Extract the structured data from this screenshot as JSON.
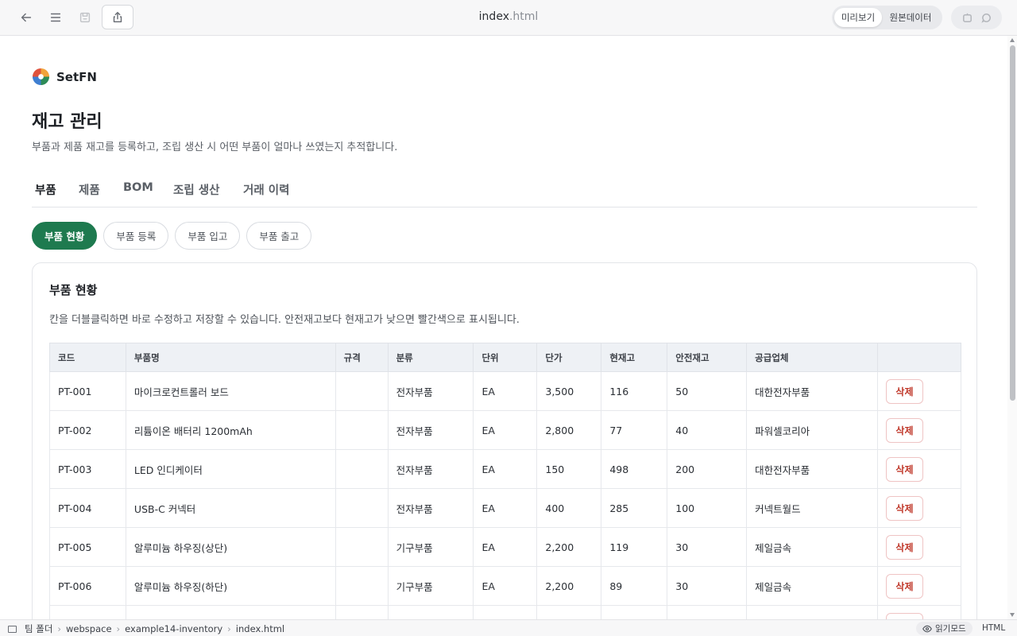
{
  "topbar": {
    "title_main": "index",
    "title_ext": ".html",
    "preview_label": "미리보기",
    "source_label": "원본데이터"
  },
  "brand": {
    "name": "SetFN"
  },
  "page": {
    "title": "재고 관리",
    "description": "부품과 제품 재고를 등록하고, 조립 생산 시 어떤 부품이 얼마나 쓰였는지 추적합니다."
  },
  "tabs": [
    "부품",
    "제품",
    "BOM",
    "조립 생산",
    "거래 이력"
  ],
  "subtabs": [
    "부품 현황",
    "부품 등록",
    "부품 입고",
    "부품 출고"
  ],
  "card": {
    "title": "부품 현황",
    "description": "칸을 더블클릭하면 바로 수정하고 저장할 수 있습니다. 안전재고보다 현재고가 낮으면 빨간색으로 표시됩니다."
  },
  "table": {
    "headers": [
      "코드",
      "부품명",
      "규격",
      "분류",
      "단위",
      "단가",
      "현재고",
      "안전재고",
      "공급업체",
      ""
    ],
    "delete_label": "삭제",
    "rows": [
      [
        "PT-001",
        "마이크로컨트롤러 보드",
        "",
        "전자부품",
        "EA",
        "3,500",
        "116",
        "50",
        "대한전자부품"
      ],
      [
        "PT-002",
        "리튬이온 배터리 1200mAh",
        "",
        "전자부품",
        "EA",
        "2,800",
        "77",
        "40",
        "파워셀코리아"
      ],
      [
        "PT-003",
        "LED 인디케이터",
        "",
        "전자부품",
        "EA",
        "150",
        "498",
        "200",
        "대한전자부품"
      ],
      [
        "PT-004",
        "USB-C 커넥터",
        "",
        "전자부품",
        "EA",
        "400",
        "285",
        "100",
        "커넥트월드"
      ],
      [
        "PT-005",
        "알루미늄 하우징(상단)",
        "",
        "기구부품",
        "EA",
        "2,200",
        "119",
        "30",
        "제일금속"
      ],
      [
        "PT-006",
        "알루미늄 하우징(하단)",
        "",
        "기구부품",
        "EA",
        "2,200",
        "89",
        "30",
        "제일금속"
      ],
      [
        "",
        "",
        "",
        "",
        "",
        "",
        "",
        "",
        ""
      ]
    ]
  },
  "statusbar": {
    "crumbs": [
      "팀 폴더",
      "webspace",
      "example14-inventory",
      "index.html"
    ],
    "read_mode": "읽기모드",
    "lang": "HTML"
  },
  "colors": {
    "accent": "#1e7a4f",
    "danger": "#c0392b"
  }
}
